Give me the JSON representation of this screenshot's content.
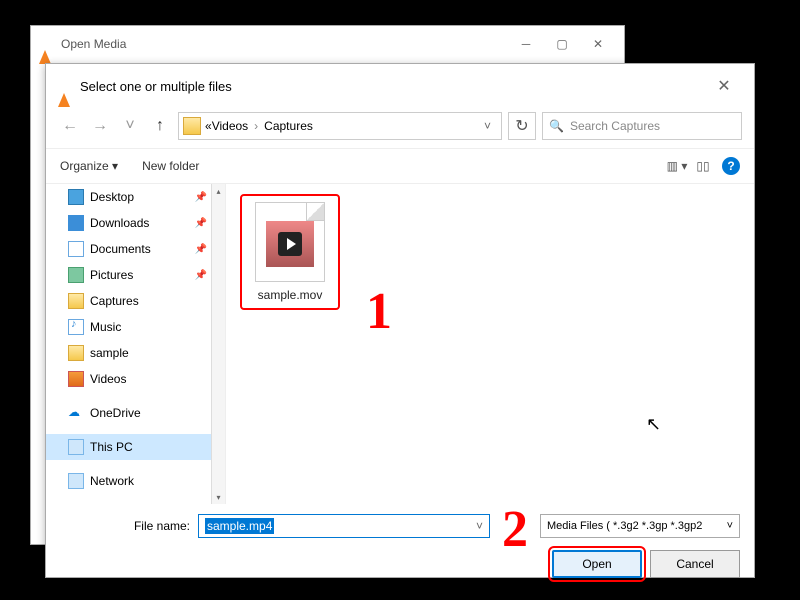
{
  "parent_window": {
    "title": "Open Media"
  },
  "dialog": {
    "title": "Select one or multiple files",
    "breadcrumb": {
      "root_glyph": "«",
      "part1": "Videos",
      "part2": "Captures"
    },
    "search": {
      "placeholder": "Search Captures"
    },
    "toolbar": {
      "organize": "Organize",
      "newfolder": "New folder"
    },
    "sidebar": {
      "items": [
        {
          "label": "Desktop",
          "icon": "ic-desktop",
          "pinned": true
        },
        {
          "label": "Downloads",
          "icon": "ic-downloads",
          "pinned": true
        },
        {
          "label": "Documents",
          "icon": "ic-documents",
          "pinned": true
        },
        {
          "label": "Pictures",
          "icon": "ic-pictures",
          "pinned": true
        },
        {
          "label": "Captures",
          "icon": "ic-folder",
          "pinned": false
        },
        {
          "label": "Music",
          "icon": "ic-music",
          "pinned": false
        },
        {
          "label": "sample",
          "icon": "ic-folder",
          "pinned": false
        },
        {
          "label": "Videos",
          "icon": "ic-videos",
          "pinned": false
        }
      ],
      "onedrive": "OneDrive",
      "thispc": "This PC",
      "network": "Network"
    },
    "file": {
      "name": "sample.mov"
    },
    "footer": {
      "filename_label": "File name:",
      "filename_value": "sample.mp4",
      "filter": "Media Files ( *.3g2 *.3gp *.3gp2",
      "open": "Open",
      "cancel": "Cancel"
    }
  },
  "annotations": {
    "one": "1",
    "two": "2"
  }
}
